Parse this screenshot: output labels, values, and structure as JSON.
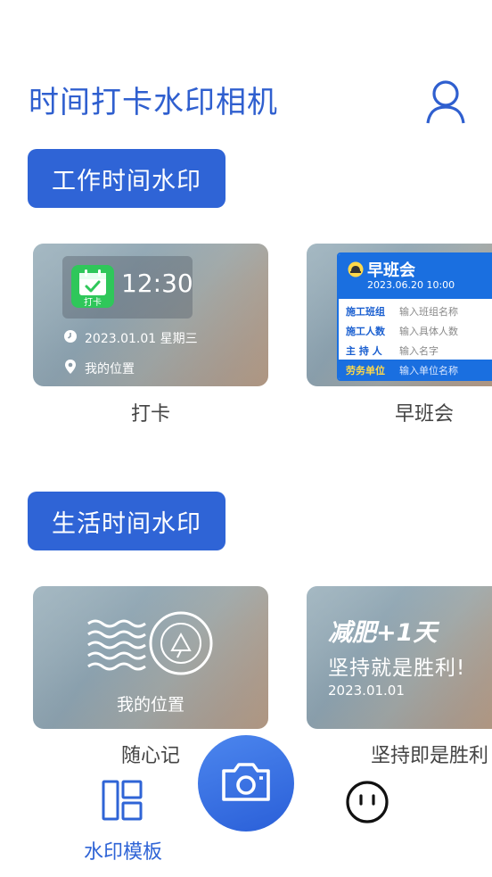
{
  "header": {
    "title": "时间打卡水印相机",
    "profile_icon": "user-outline-icon"
  },
  "sections": {
    "work": {
      "label": "工作时间水印"
    },
    "life": {
      "label": "生活时间水印"
    }
  },
  "cards": {
    "checkin": {
      "label": "打卡",
      "badge_text": "打卡",
      "time": "12:30",
      "date": "2023.01.01 星期三",
      "location": "我的位置"
    },
    "morning_meeting": {
      "label": "早班会",
      "title": "早班会",
      "datetime": "2023.06.20 10:00",
      "rows": [
        {
          "key": "施工班组",
          "value": "输入班组名称"
        },
        {
          "key": "施工人数",
          "value": "输入具体人数"
        },
        {
          "key": "主 持 人",
          "value": "输入名字"
        },
        {
          "key": "劳务单位",
          "value": "输入单位名称"
        }
      ]
    },
    "journal": {
      "label": "随心记",
      "location": "我的位置"
    },
    "persist": {
      "label": "坚持即是胜利",
      "line1": "减肥+1天",
      "line2": "坚持就是胜利!",
      "date": "2023.01.01"
    }
  },
  "bottom_nav": {
    "templates_label": "水印模板",
    "camera_icon": "camera-icon",
    "profile_icon": "smile-face-icon"
  },
  "colors": {
    "accent": "#2f64d6",
    "title_blue": "#2f5fcf",
    "green": "#2fc75a",
    "meeting_blue": "#1a6fe0",
    "highlight_yellow": "#ffd84a"
  }
}
